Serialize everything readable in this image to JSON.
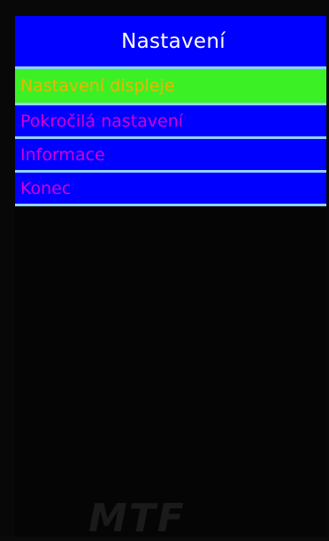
{
  "header": {
    "title": "Nastavení"
  },
  "menu": {
    "items": [
      {
        "label": "Nastavení displeje",
        "selected": true
      },
      {
        "label": "Pokročilá nastavení",
        "selected": false
      },
      {
        "label": "Informace",
        "selected": false
      },
      {
        "label": "Konec",
        "selected": false
      }
    ]
  },
  "brand": {
    "logo_text": "MTF"
  },
  "colors": {
    "header_bg": "#0000ff",
    "item_bg": "#0000ff",
    "item_text": "#d400d4",
    "selected_bg": "#3cf026",
    "selected_text": "#e8b800",
    "divider": "#8fd3ff",
    "screen_bg": "#050505"
  }
}
